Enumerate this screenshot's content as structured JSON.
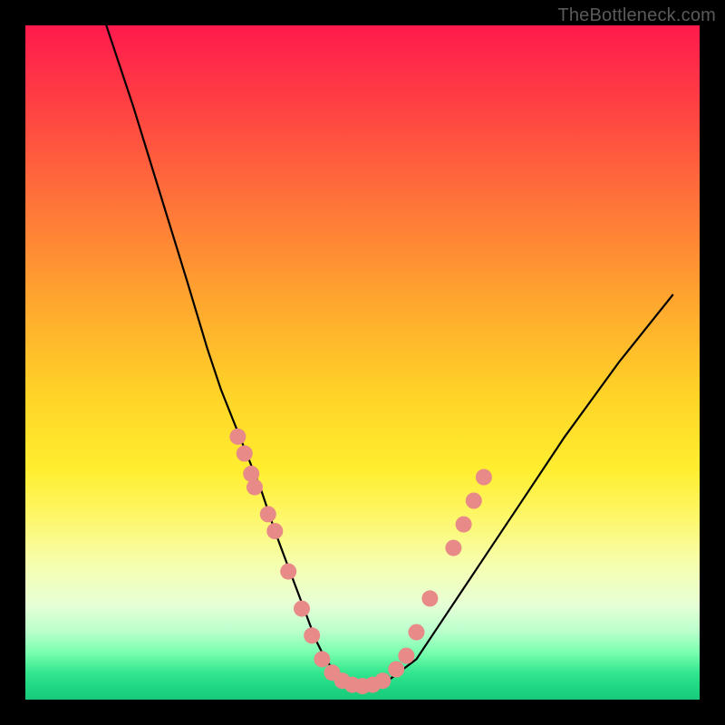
{
  "watermark": "TheBottleneck.com",
  "chart_data": {
    "type": "line",
    "title": "",
    "xlabel": "",
    "ylabel": "",
    "xlim": [
      0,
      100
    ],
    "ylim": [
      0,
      100
    ],
    "grid": false,
    "series": [
      {
        "name": "bottleneck-curve",
        "x": [
          12,
          16,
          20,
          24,
          27,
          29,
          31,
          33,
          35,
          37,
          38.5,
          40,
          41.5,
          43,
          44.5,
          46,
          48,
          50,
          54,
          58,
          62,
          68,
          74,
          80,
          88,
          96
        ],
        "y": [
          100,
          88,
          75,
          62,
          52,
          46,
          41,
          36,
          31,
          25,
          21,
          17,
          13,
          9,
          6,
          4,
          2.5,
          2,
          3,
          6,
          12,
          21,
          30,
          39,
          50,
          60
        ]
      }
    ],
    "markers": [
      {
        "name": "scatter-dots",
        "color": "#e78a88",
        "radius_px": 9,
        "points": [
          {
            "x": 31.5,
            "y": 39
          },
          {
            "x": 32.5,
            "y": 36.5
          },
          {
            "x": 33.5,
            "y": 33.5
          },
          {
            "x": 34.0,
            "y": 31.5
          },
          {
            "x": 36.0,
            "y": 27.5
          },
          {
            "x": 37.0,
            "y": 25.0
          },
          {
            "x": 39.0,
            "y": 19.0
          },
          {
            "x": 41.0,
            "y": 13.5
          },
          {
            "x": 42.5,
            "y": 9.5
          },
          {
            "x": 44.0,
            "y": 6.0
          },
          {
            "x": 45.5,
            "y": 4.0
          },
          {
            "x": 47.0,
            "y": 2.8
          },
          {
            "x": 48.5,
            "y": 2.2
          },
          {
            "x": 50.0,
            "y": 2.0
          },
          {
            "x": 51.5,
            "y": 2.2
          },
          {
            "x": 53.0,
            "y": 2.8
          },
          {
            "x": 55.0,
            "y": 4.5
          },
          {
            "x": 56.5,
            "y": 6.5
          },
          {
            "x": 58.0,
            "y": 10.0
          },
          {
            "x": 60.0,
            "y": 15.0
          },
          {
            "x": 63.5,
            "y": 22.5
          },
          {
            "x": 65.0,
            "y": 26.0
          },
          {
            "x": 66.5,
            "y": 29.5
          },
          {
            "x": 68.0,
            "y": 33.0
          }
        ]
      }
    ]
  }
}
